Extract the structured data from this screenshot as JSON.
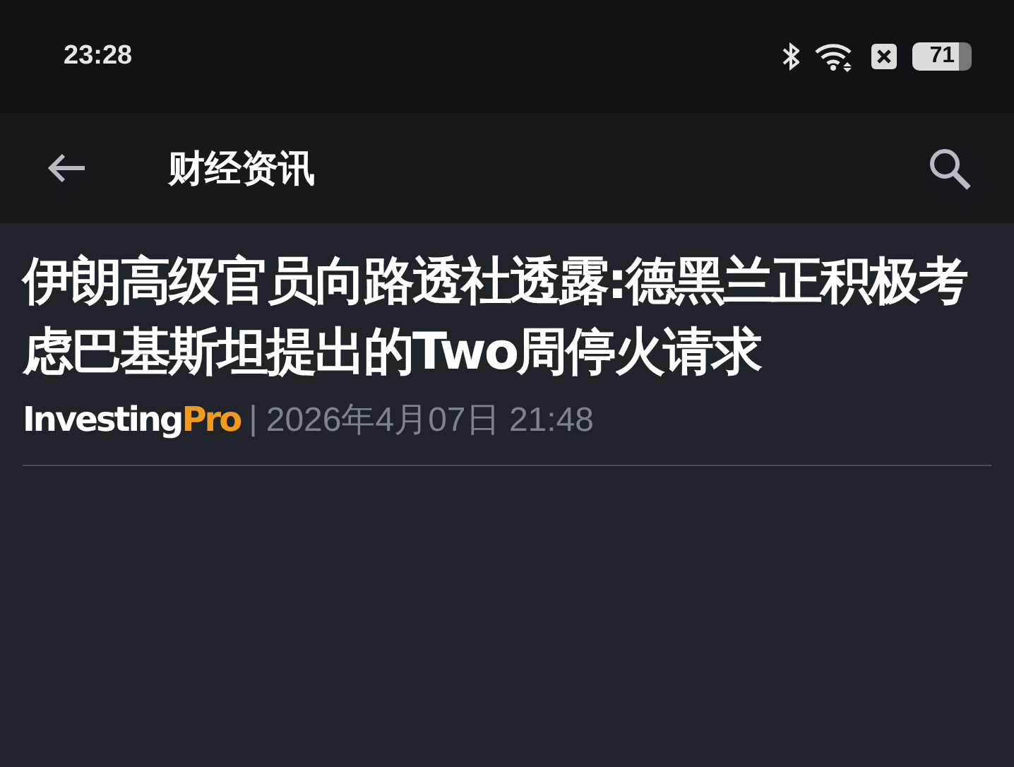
{
  "status_bar": {
    "time": "23:28",
    "battery": "71"
  },
  "app_bar": {
    "title": "财经资讯"
  },
  "article": {
    "headline": "伊朗高级官员向路透社透露:德黑兰正积极考虑巴基斯坦提出的Two周停火请求",
    "source_name": "Investing",
    "source_accent": "Pro",
    "separator": "|",
    "date": "2026年4月07日 21:48"
  }
}
